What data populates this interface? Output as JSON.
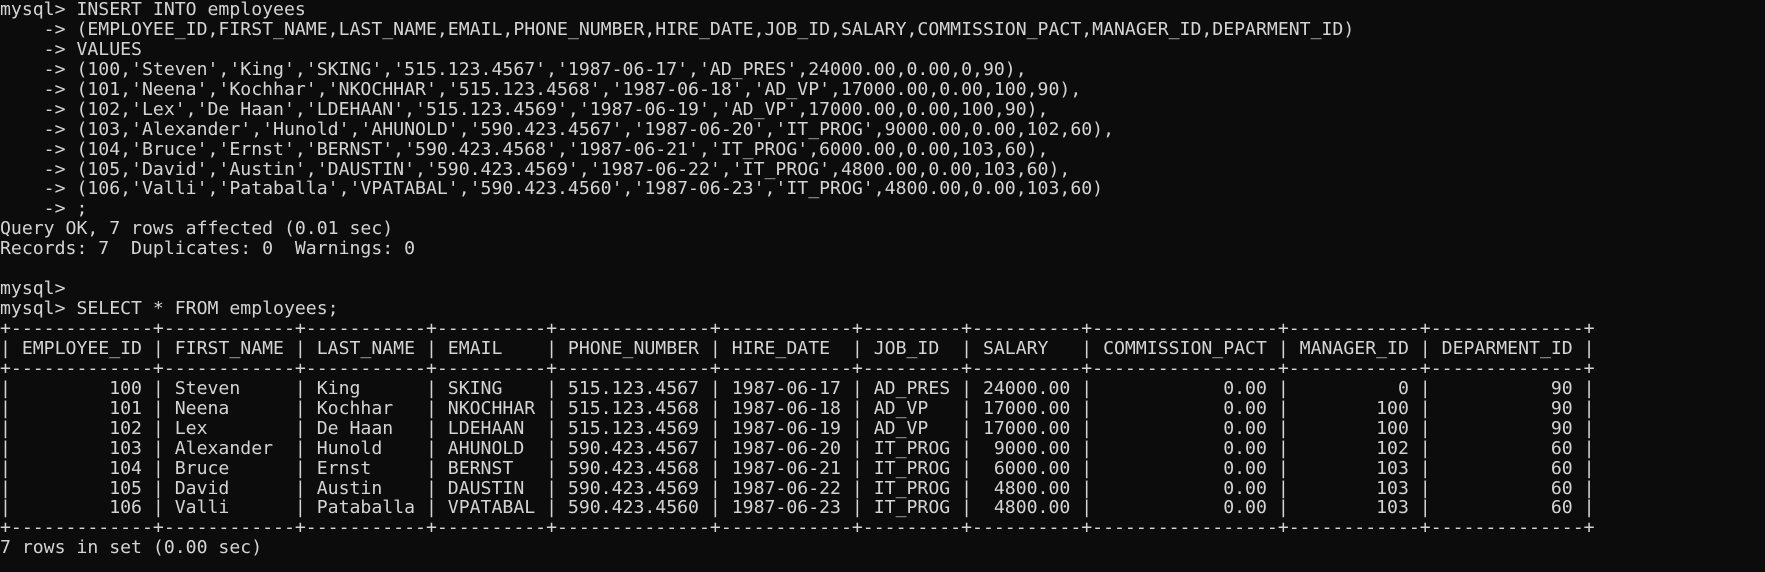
{
  "terminal": {
    "lines": [
      "mysql> INSERT INTO employees",
      "    -> (EMPLOYEE_ID,FIRST_NAME,LAST_NAME,EMAIL,PHONE_NUMBER,HIRE_DATE,JOB_ID,SALARY,COMMISSION_PACT,MANAGER_ID,DEPARMENT_ID)",
      "    -> VALUES",
      "    -> (100,'Steven','King','SKING','515.123.4567','1987-06-17','AD_PRES',24000.00,0.00,0,90),",
      "    -> (101,'Neena','Kochhar','NKOCHHAR','515.123.4568','1987-06-18','AD_VP',17000.00,0.00,100,90),",
      "    -> (102,'Lex','De Haan','LDEHAAN','515.123.4569','1987-06-19','AD_VP',17000.00,0.00,100,90),",
      "    -> (103,'Alexander','Hunold','AHUNOLD','590.423.4567','1987-06-20','IT_PROG',9000.00,0.00,102,60),",
      "    -> (104,'Bruce','Ernst','BERNST','590.423.4568','1987-06-21','IT_PROG',6000.00,0.00,103,60),",
      "    -> (105,'David','Austin','DAUSTIN','590.423.4569','1987-06-22','IT_PROG',4800.00,0.00,103,60),",
      "    -> (106,'Valli','Pataballa','VPATABAL','590.423.4560','1987-06-23','IT_PROG',4800.00,0.00,103,60)",
      "    -> ;",
      "Query OK, 7 rows affected (0.01 sec)",
      "Records: 7  Duplicates: 0  Warnings: 0",
      "",
      "mysql>",
      "mysql> SELECT * FROM employees;",
      "+-------------+------------+-----------+----------+--------------+------------+---------+----------+-----------------+------------+--------------+",
      "| EMPLOYEE_ID | FIRST_NAME | LAST_NAME | EMAIL    | PHONE_NUMBER | HIRE_DATE  | JOB_ID  | SALARY   | COMMISSION_PACT | MANAGER_ID | DEPARMENT_ID |",
      "+-------------+------------+-----------+----------+--------------+------------+---------+----------+-----------------+------------+--------------+",
      "|         100 | Steven     | King      | SKING    | 515.123.4567 | 1987-06-17 | AD_PRES | 24000.00 |            0.00 |          0 |           90 |",
      "|         101 | Neena      | Kochhar   | NKOCHHAR | 515.123.4568 | 1987-06-18 | AD_VP   | 17000.00 |            0.00 |        100 |           90 |",
      "|         102 | Lex        | De Haan   | LDEHAAN  | 515.123.4569 | 1987-06-19 | AD_VP   | 17000.00 |            0.00 |        100 |           90 |",
      "|         103 | Alexander  | Hunold    | AHUNOLD  | 590.423.4567 | 1987-06-20 | IT_PROG |  9000.00 |            0.00 |        102 |           60 |",
      "|         104 | Bruce      | Ernst     | BERNST   | 590.423.4568 | 1987-06-21 | IT_PROG |  6000.00 |            0.00 |        103 |           60 |",
      "|         105 | David      | Austin    | DAUSTIN  | 590.423.4569 | 1987-06-22 | IT_PROG |  4800.00 |            0.00 |        103 |           60 |",
      "|         106 | Valli      | Pataballa | VPATABAL | 590.423.4560 | 1987-06-23 | IT_PROG |  4800.00 |            0.00 |        103 |           60 |",
      "+-------------+------------+-----------+----------+--------------+------------+---------+----------+-----------------+------------+--------------+",
      "7 rows in set (0.00 sec)"
    ]
  }
}
